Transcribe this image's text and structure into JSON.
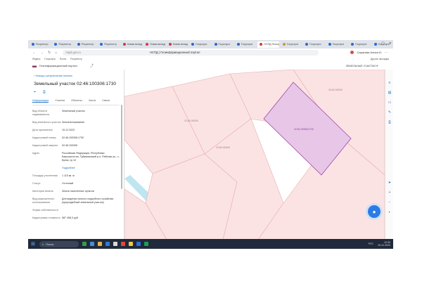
{
  "browser": {
    "tabs": [
      {
        "label": "Росреестр",
        "color": "#2a6ad1"
      },
      {
        "label": "Росреестр",
        "color": "#2a6ad1"
      },
      {
        "label": "Росреестр",
        "color": "#2a6ad1"
      },
      {
        "label": "Росреестр",
        "color": "#2a6ad1"
      },
      {
        "label": "Новая вкладка",
        "color": "#d33a3a"
      },
      {
        "label": "Новая вкладка",
        "color": "#d33a3a"
      },
      {
        "label": "Новая вкладка",
        "color": "#d33a3a"
      },
      {
        "label": "Госуслуги",
        "color": "#2a6ad1"
      },
      {
        "label": "Госуслуги",
        "color": "#2a6ad1"
      },
      {
        "label": "Госуслуги",
        "color": "#2a6ad1"
      },
      {
        "label": "НСПД Геопортал",
        "color": "#d33a3a",
        "active": true
      },
      {
        "label": "Госуслуги",
        "color": "#e0922a"
      },
      {
        "label": "Госуслуги",
        "color": "#2a6ad1"
      },
      {
        "label": "Госуслуги",
        "color": "#2a6ad1"
      },
      {
        "label": "Госуслуги",
        "color": "#2a6ad1"
      },
      {
        "label": "Госуслуги",
        "color": "#2a6ad1"
      }
    ],
    "url_host": "nspd.gov.ru",
    "page_title": "НСПД | Геоинформационный портал",
    "profile_name": "Саратова Алиса И.",
    "bookmarks": [
      "Яндекс",
      "Госуслуги",
      "Почта",
      "Росреестр"
    ],
    "bookmarks_right": "Другие закладки"
  },
  "app": {
    "header_title": "Геоинформационный портал",
    "layer_dropdown": "ЗЕМЕЛЬНЫЕ УЧАСТКИ",
    "back_link": "Назад к результатам поиска",
    "object_title": "Земельный участок 02:46:100306:1730",
    "tabs": [
      "Информация",
      "Участки",
      "Объекты",
      "Части",
      "Связи"
    ],
    "rows": [
      {
        "key": "Вид объекта недвижимости",
        "value": "Земельный участок",
        "link": false
      },
      {
        "key": "Вид земельного участка",
        "value": "Землепользование",
        "link": false
      },
      {
        "key": "Дата присвоения",
        "value": "15.12.2023",
        "link": false
      },
      {
        "key": "Кадастровый номер",
        "value": "02:46:100306:1730",
        "link": false
      },
      {
        "key": "Кадастровый квартал",
        "value": "02:46:100306",
        "link": false
      },
      {
        "key": "Адрес",
        "value": "Российская Федерация, Республика Башкортостан, Туймазинский р-н, Рабочая ул., с. Буляк, зу 10",
        "link": false
      },
      {
        "key": "",
        "value": "Подробнее",
        "link": true
      },
      {
        "key": "Площадь уточненная",
        "value": "1 115 кв. м",
        "link": false
      },
      {
        "key": "Статус",
        "value": "Учтенный",
        "link": false
      },
      {
        "key": "Категория земель",
        "value": "Земли населенных пунктов",
        "link": false
      },
      {
        "key": "Вид разрешенного использования",
        "value": "Для ведения личного подсобного хозяйства (приусадебный земельный участок)",
        "link": false
      },
      {
        "key": "Форма собственности",
        "value": "",
        "link": false
      },
      {
        "key": "Кадастровая стоимость",
        "value": "587 458,3 руб.",
        "link": false
      }
    ],
    "legend_label": "Легенда",
    "map_labels": {
      "main_parcel": "02:46:100306:1730",
      "parcel_a": "02:46:100306",
      "parcel_b": "02:46:100306",
      "parcel_c": "02:46:100306"
    }
  },
  "taskbar": {
    "search_label": "Поиск",
    "tray_lang": "РУС",
    "time": "12:30",
    "date": "15.12.2024"
  },
  "colors": {
    "parcel_fill": "#fbe3e3",
    "parcel_stroke": "#e7b0b0",
    "selected_fill": "#e7c6e8",
    "selected_stroke": "#a04aa8",
    "road": "#bfe6f0",
    "accent": "#1a73c7"
  }
}
